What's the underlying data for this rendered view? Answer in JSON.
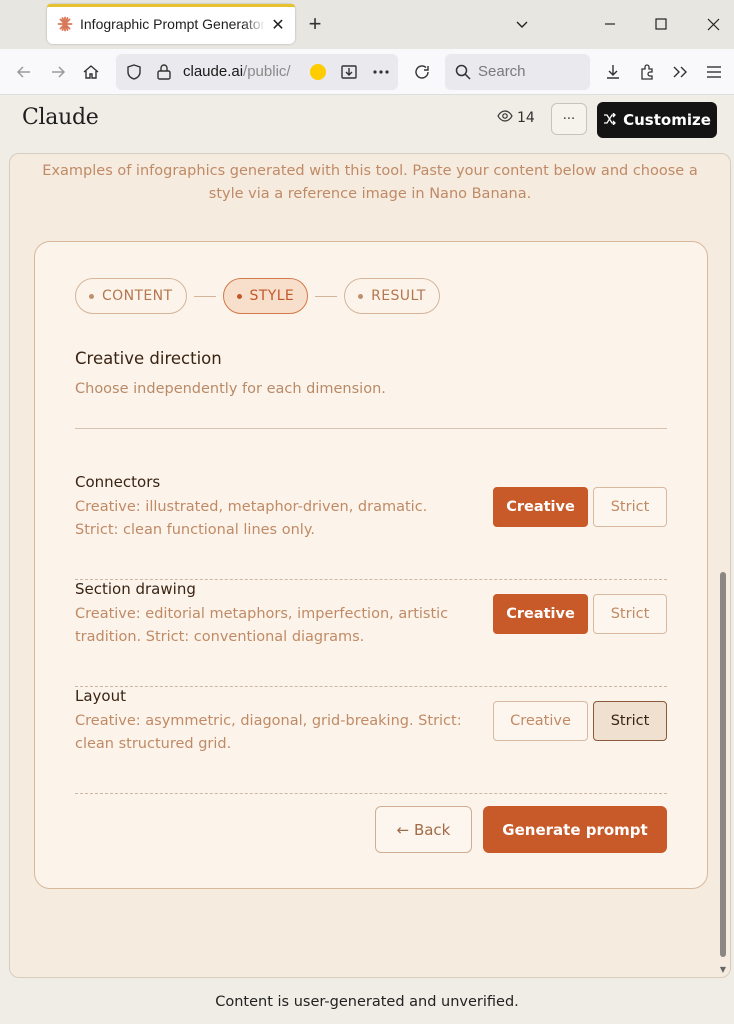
{
  "browser": {
    "tab_title": "Infographic Prompt Generator f",
    "url_host": "claude.ai",
    "url_path": "/public/",
    "search_placeholder": "Search"
  },
  "header": {
    "brand": "Claude",
    "views": "14",
    "more_label": "···",
    "customize_label": "Customize"
  },
  "artifact": {
    "intro": "Examples of infographics generated with this tool. Paste your content below and choose a style via a reference image in Nano Banana.",
    "steps": [
      {
        "label": "CONTENT",
        "active": false
      },
      {
        "label": "STYLE",
        "active": true
      },
      {
        "label": "RESULT",
        "active": false
      }
    ],
    "heading": "Creative direction",
    "subheading": "Choose independently for each dimension.",
    "options": [
      {
        "title": "Connectors",
        "desc": "Creative: illustrated, metaphor-driven, dramatic. Strict: clean functional lines only.",
        "creative_label": "Creative",
        "strict_label": "Strict",
        "selected": "creative"
      },
      {
        "title": "Section drawing",
        "desc": "Creative: editorial metaphors, imperfection, artistic tradition. Strict: conventional diagrams.",
        "creative_label": "Creative",
        "strict_label": "Strict",
        "selected": "creative"
      },
      {
        "title": "Layout",
        "desc": "Creative: asymmetric, diagonal, grid-breaking. Strict: clean structured grid.",
        "creative_label": "Creative",
        "strict_label": "Strict",
        "selected": "strict"
      }
    ],
    "back_label": "← Back",
    "generate_label": "Generate prompt"
  },
  "footer": "Content is user-generated and unverified.",
  "colors": {
    "accent": "#c85a2a",
    "card_bg": "#fcf4ea",
    "muted_text": "#c08a66"
  }
}
